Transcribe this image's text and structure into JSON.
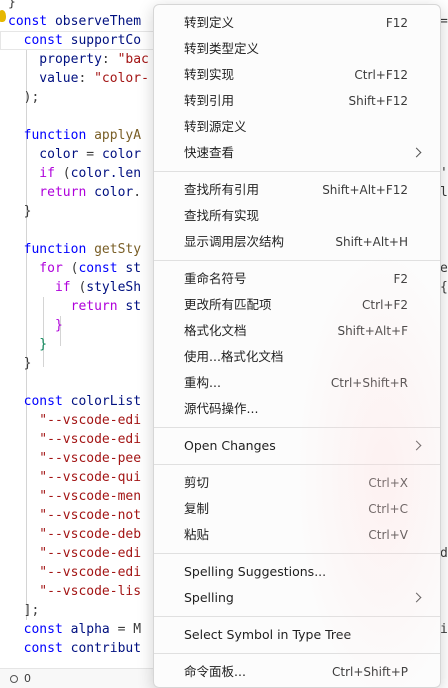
{
  "editor": {
    "lines": [
      {
        "tokens": [
          {
            "t": "}",
            "c": "pun"
          }
        ]
      },
      {
        "tokens": [
          {
            "t": "const ",
            "c": "kw"
          },
          {
            "t": "observeThem",
            "c": "id"
          }
        ]
      },
      {
        "tokens": [
          {
            "t": "  const ",
            "c": "kw"
          },
          {
            "t": "supportCo",
            "c": "id"
          }
        ]
      },
      {
        "tokens": [
          {
            "t": "    property",
            "c": "id"
          },
          {
            "t": ": ",
            "c": "pun"
          },
          {
            "t": "\"bac",
            "c": "str"
          }
        ]
      },
      {
        "tokens": [
          {
            "t": "    value",
            "c": "id"
          },
          {
            "t": ": ",
            "c": "pun"
          },
          {
            "t": "\"color-",
            "c": "str"
          }
        ]
      },
      {
        "tokens": [
          {
            "t": "  );",
            "c": "pun"
          }
        ]
      },
      {
        "tokens": []
      },
      {
        "tokens": [
          {
            "t": "  function ",
            "c": "kw"
          },
          {
            "t": "applyA",
            "c": "fn"
          }
        ]
      },
      {
        "tokens": [
          {
            "t": "    color",
            "c": "id"
          },
          {
            "t": " = ",
            "c": "pun"
          },
          {
            "t": "color",
            "c": "id"
          }
        ]
      },
      {
        "tokens": [
          {
            "t": "    if ",
            "c": "purple"
          },
          {
            "t": "(",
            "c": "pun"
          },
          {
            "t": "color",
            "c": "id"
          },
          {
            "t": ".len",
            "c": "id"
          }
        ]
      },
      {
        "tokens": [
          {
            "t": "    return ",
            "c": "purple"
          },
          {
            "t": "color",
            "c": "id"
          },
          {
            "t": ".",
            "c": "pun"
          }
        ]
      },
      {
        "tokens": [
          {
            "t": "  }",
            "c": "pun"
          }
        ]
      },
      {
        "tokens": []
      },
      {
        "tokens": [
          {
            "t": "  function ",
            "c": "kw"
          },
          {
            "t": "getSty",
            "c": "fn"
          }
        ]
      },
      {
        "tokens": [
          {
            "t": "    for ",
            "c": "purple"
          },
          {
            "t": "(",
            "c": "pun"
          },
          {
            "t": "const ",
            "c": "kw"
          },
          {
            "t": "st",
            "c": "id"
          }
        ]
      },
      {
        "tokens": [
          {
            "t": "      if ",
            "c": "purple"
          },
          {
            "t": "(",
            "c": "pun"
          },
          {
            "t": "styleSh",
            "c": "id"
          }
        ]
      },
      {
        "tokens": [
          {
            "t": "        return ",
            "c": "purple"
          },
          {
            "t": "st",
            "c": "id"
          }
        ]
      },
      {
        "tokens": [
          {
            "t": "      }",
            "c": "purple"
          }
        ]
      },
      {
        "tokens": [
          {
            "t": "    }",
            "c": "green"
          }
        ]
      },
      {
        "tokens": [
          {
            "t": "  }",
            "c": "pun"
          }
        ]
      },
      {
        "tokens": []
      },
      {
        "tokens": [
          {
            "t": "  const ",
            "c": "kw"
          },
          {
            "t": "colorList",
            "c": "id"
          }
        ]
      },
      {
        "tokens": [
          {
            "t": "    \"--vscode-edi",
            "c": "str"
          }
        ]
      },
      {
        "tokens": [
          {
            "t": "    \"--vscode-edi",
            "c": "str"
          }
        ]
      },
      {
        "tokens": [
          {
            "t": "    \"--vscode-pee",
            "c": "str"
          }
        ]
      },
      {
        "tokens": [
          {
            "t": "    \"--vscode-qui",
            "c": "str"
          }
        ]
      },
      {
        "tokens": [
          {
            "t": "    \"--vscode-men",
            "c": "str"
          }
        ]
      },
      {
        "tokens": [
          {
            "t": "    \"--vscode-not",
            "c": "str"
          }
        ]
      },
      {
        "tokens": [
          {
            "t": "    \"--vscode-deb",
            "c": "str"
          }
        ]
      },
      {
        "tokens": [
          {
            "t": "    \"--vscode-edi",
            "c": "str"
          }
        ]
      },
      {
        "tokens": [
          {
            "t": "    \"--vscode-edi",
            "c": "str"
          }
        ]
      },
      {
        "tokens": [
          {
            "t": "    \"--vscode-lis",
            "c": "str"
          }
        ]
      },
      {
        "tokens": [
          {
            "t": "  ];",
            "c": "pun"
          }
        ]
      },
      {
        "tokens": [
          {
            "t": "  const ",
            "c": "kw"
          },
          {
            "t": "alpha",
            "c": "id"
          },
          {
            "t": " = M",
            "c": "pun"
          }
        ]
      },
      {
        "tokens": [
          {
            "t": "  const ",
            "c": "kw"
          },
          {
            "t": "contribut",
            "c": "id"
          }
        ]
      }
    ],
    "right_fragments": [
      {
        "line": 1,
        "text": "="
      },
      {
        "line": 9,
        "text": "'"
      },
      {
        "line": 10,
        "text": "l"
      },
      {
        "line": 14,
        "text": "e"
      },
      {
        "line": 15,
        "text": "{"
      },
      {
        "line": 29,
        "text": "d"
      },
      {
        "line": 33,
        "text": "ir"
      }
    ]
  },
  "status": {
    "ports": "0"
  },
  "menu": {
    "groups": [
      [
        {
          "label": "转到定义",
          "key": "F12"
        },
        {
          "label": "转到类型定义",
          "key": ""
        },
        {
          "label": "转到实现",
          "key": "Ctrl+F12"
        },
        {
          "label": "转到引用",
          "key": "Shift+F12"
        },
        {
          "label": "转到源定义",
          "key": ""
        },
        {
          "label": "快速查看",
          "key": "",
          "submenu": true
        }
      ],
      [
        {
          "label": "查找所有引用",
          "key": "Shift+Alt+F12"
        },
        {
          "label": "查找所有实现",
          "key": ""
        },
        {
          "label": "显示调用层次结构",
          "key": "Shift+Alt+H"
        }
      ],
      [
        {
          "label": "重命名符号",
          "key": "F2"
        },
        {
          "label": "更改所有匹配项",
          "key": "Ctrl+F2"
        },
        {
          "label": "格式化文档",
          "key": "Shift+Alt+F"
        },
        {
          "label": "使用...格式化文档",
          "key": ""
        },
        {
          "label": "重构...",
          "key": "Ctrl+Shift+R"
        },
        {
          "label": "源代码操作...",
          "key": ""
        }
      ],
      [
        {
          "label": "Open Changes",
          "key": "",
          "submenu": true
        }
      ],
      [
        {
          "label": "剪切",
          "key": "Ctrl+X"
        },
        {
          "label": "复制",
          "key": "Ctrl+C"
        },
        {
          "label": "粘贴",
          "key": "Ctrl+V"
        }
      ],
      [
        {
          "label": "Spelling Suggestions...",
          "key": ""
        },
        {
          "label": "Spelling",
          "key": "",
          "submenu": true
        }
      ],
      [
        {
          "label": "Select Symbol in Type Tree",
          "key": ""
        }
      ],
      [
        {
          "label": "命令面板...",
          "key": "Ctrl+Shift+P"
        }
      ]
    ]
  }
}
